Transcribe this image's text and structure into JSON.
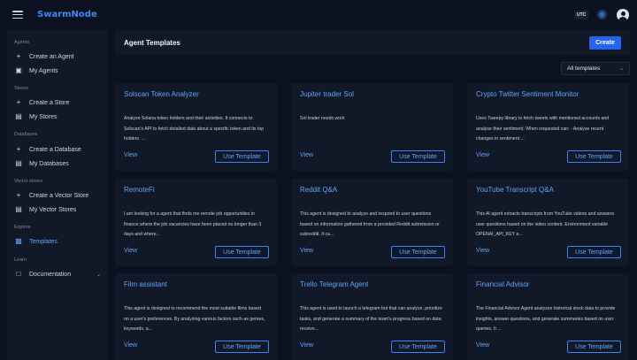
{
  "app": {
    "brand": "SwarmNode",
    "utc_label": "UTC"
  },
  "sidebar": {
    "sections": [
      {
        "title": "Agents",
        "items": [
          {
            "label": "Create an Agent",
            "icon": "plus-icon"
          },
          {
            "label": "My Agents",
            "icon": "robot-icon"
          }
        ]
      },
      {
        "title": "Stores",
        "items": [
          {
            "label": "Create a Store",
            "icon": "plus-icon"
          },
          {
            "label": "My Stores",
            "icon": "database-icon"
          }
        ]
      },
      {
        "title": "Databases",
        "items": [
          {
            "label": "Create a Database",
            "icon": "plus-icon"
          },
          {
            "label": "My Databases",
            "icon": "database-icon"
          }
        ]
      },
      {
        "title": "Vector stores",
        "items": [
          {
            "label": "Create a Vector Store",
            "icon": "plus-icon"
          },
          {
            "label": "My Vector Stores",
            "icon": "database-icon"
          }
        ]
      },
      {
        "title": "Explore",
        "items": [
          {
            "label": "Templates",
            "icon": "templates-icon",
            "active": true
          }
        ]
      },
      {
        "title": "Learn",
        "items": [
          {
            "label": "Documentation",
            "icon": "book-icon"
          }
        ]
      }
    ]
  },
  "header": {
    "title": "Agent Templates",
    "create_label": "Create"
  },
  "filter": {
    "selected": "All templates"
  },
  "templates": [
    {
      "title": "Solscan Token Analyzer",
      "description": "Analyze Solana token holders and their activities. It connects to Solscan's API to fetch detailed data about a specific token and its top holders. ...",
      "view": "View",
      "use": "Use Template"
    },
    {
      "title": "Jupiter trader Sol",
      "description": "Sol trader needs work",
      "view": "View",
      "use": "Use Template"
    },
    {
      "title": "Crypto Twitter Sentiment Monitor",
      "description": "Uses Tweepy library to fetch tweets with mentioned accounts and analyse their sentiment. When requested can: - Analyse recent changes in sentiment ...",
      "view": "View",
      "use": "Use Template"
    },
    {
      "title": "RemoteFi",
      "description": "I am looking for a agent that finds me remote job opportunities in finance where the job vacancies have been placed no longer than 3 days and where...",
      "view": "View",
      "use": "Use Template"
    },
    {
      "title": "Reddit Q&A",
      "description": "This agent is designed to analyze and respond to user questions based on information gathered from a provided Reddit submission or subreddit. It ca...",
      "view": "View",
      "use": "Use Template"
    },
    {
      "title": "YouTube Transcript Q&A",
      "description": "This AI agent extracts transcripts from YouTube videos and answers user questions based on the video content. Environment variable OPENAI_API_KEY a...",
      "view": "View",
      "use": "Use Template"
    },
    {
      "title": "Film assistant",
      "description": "This agent is designed to recommend the most suitable films based on a user's preferences. By analyzing various factors such as genres, keywords, a...",
      "view": "View",
      "use": "Use Template"
    },
    {
      "title": "Trello Telegram Agent",
      "description": "This agent is used to launch a telegram bot that can analyze, prioritize tasks, and generate a summary of the team's progress based on data receive...",
      "view": "View",
      "use": "Use Template"
    },
    {
      "title": "Financial Advisor",
      "description": "The Financial Advisor Agent analyzes historical stock data to provide insights, answer questions, and generate summaries based on user queries. It ...",
      "view": "View",
      "use": "Use Template"
    }
  ]
}
